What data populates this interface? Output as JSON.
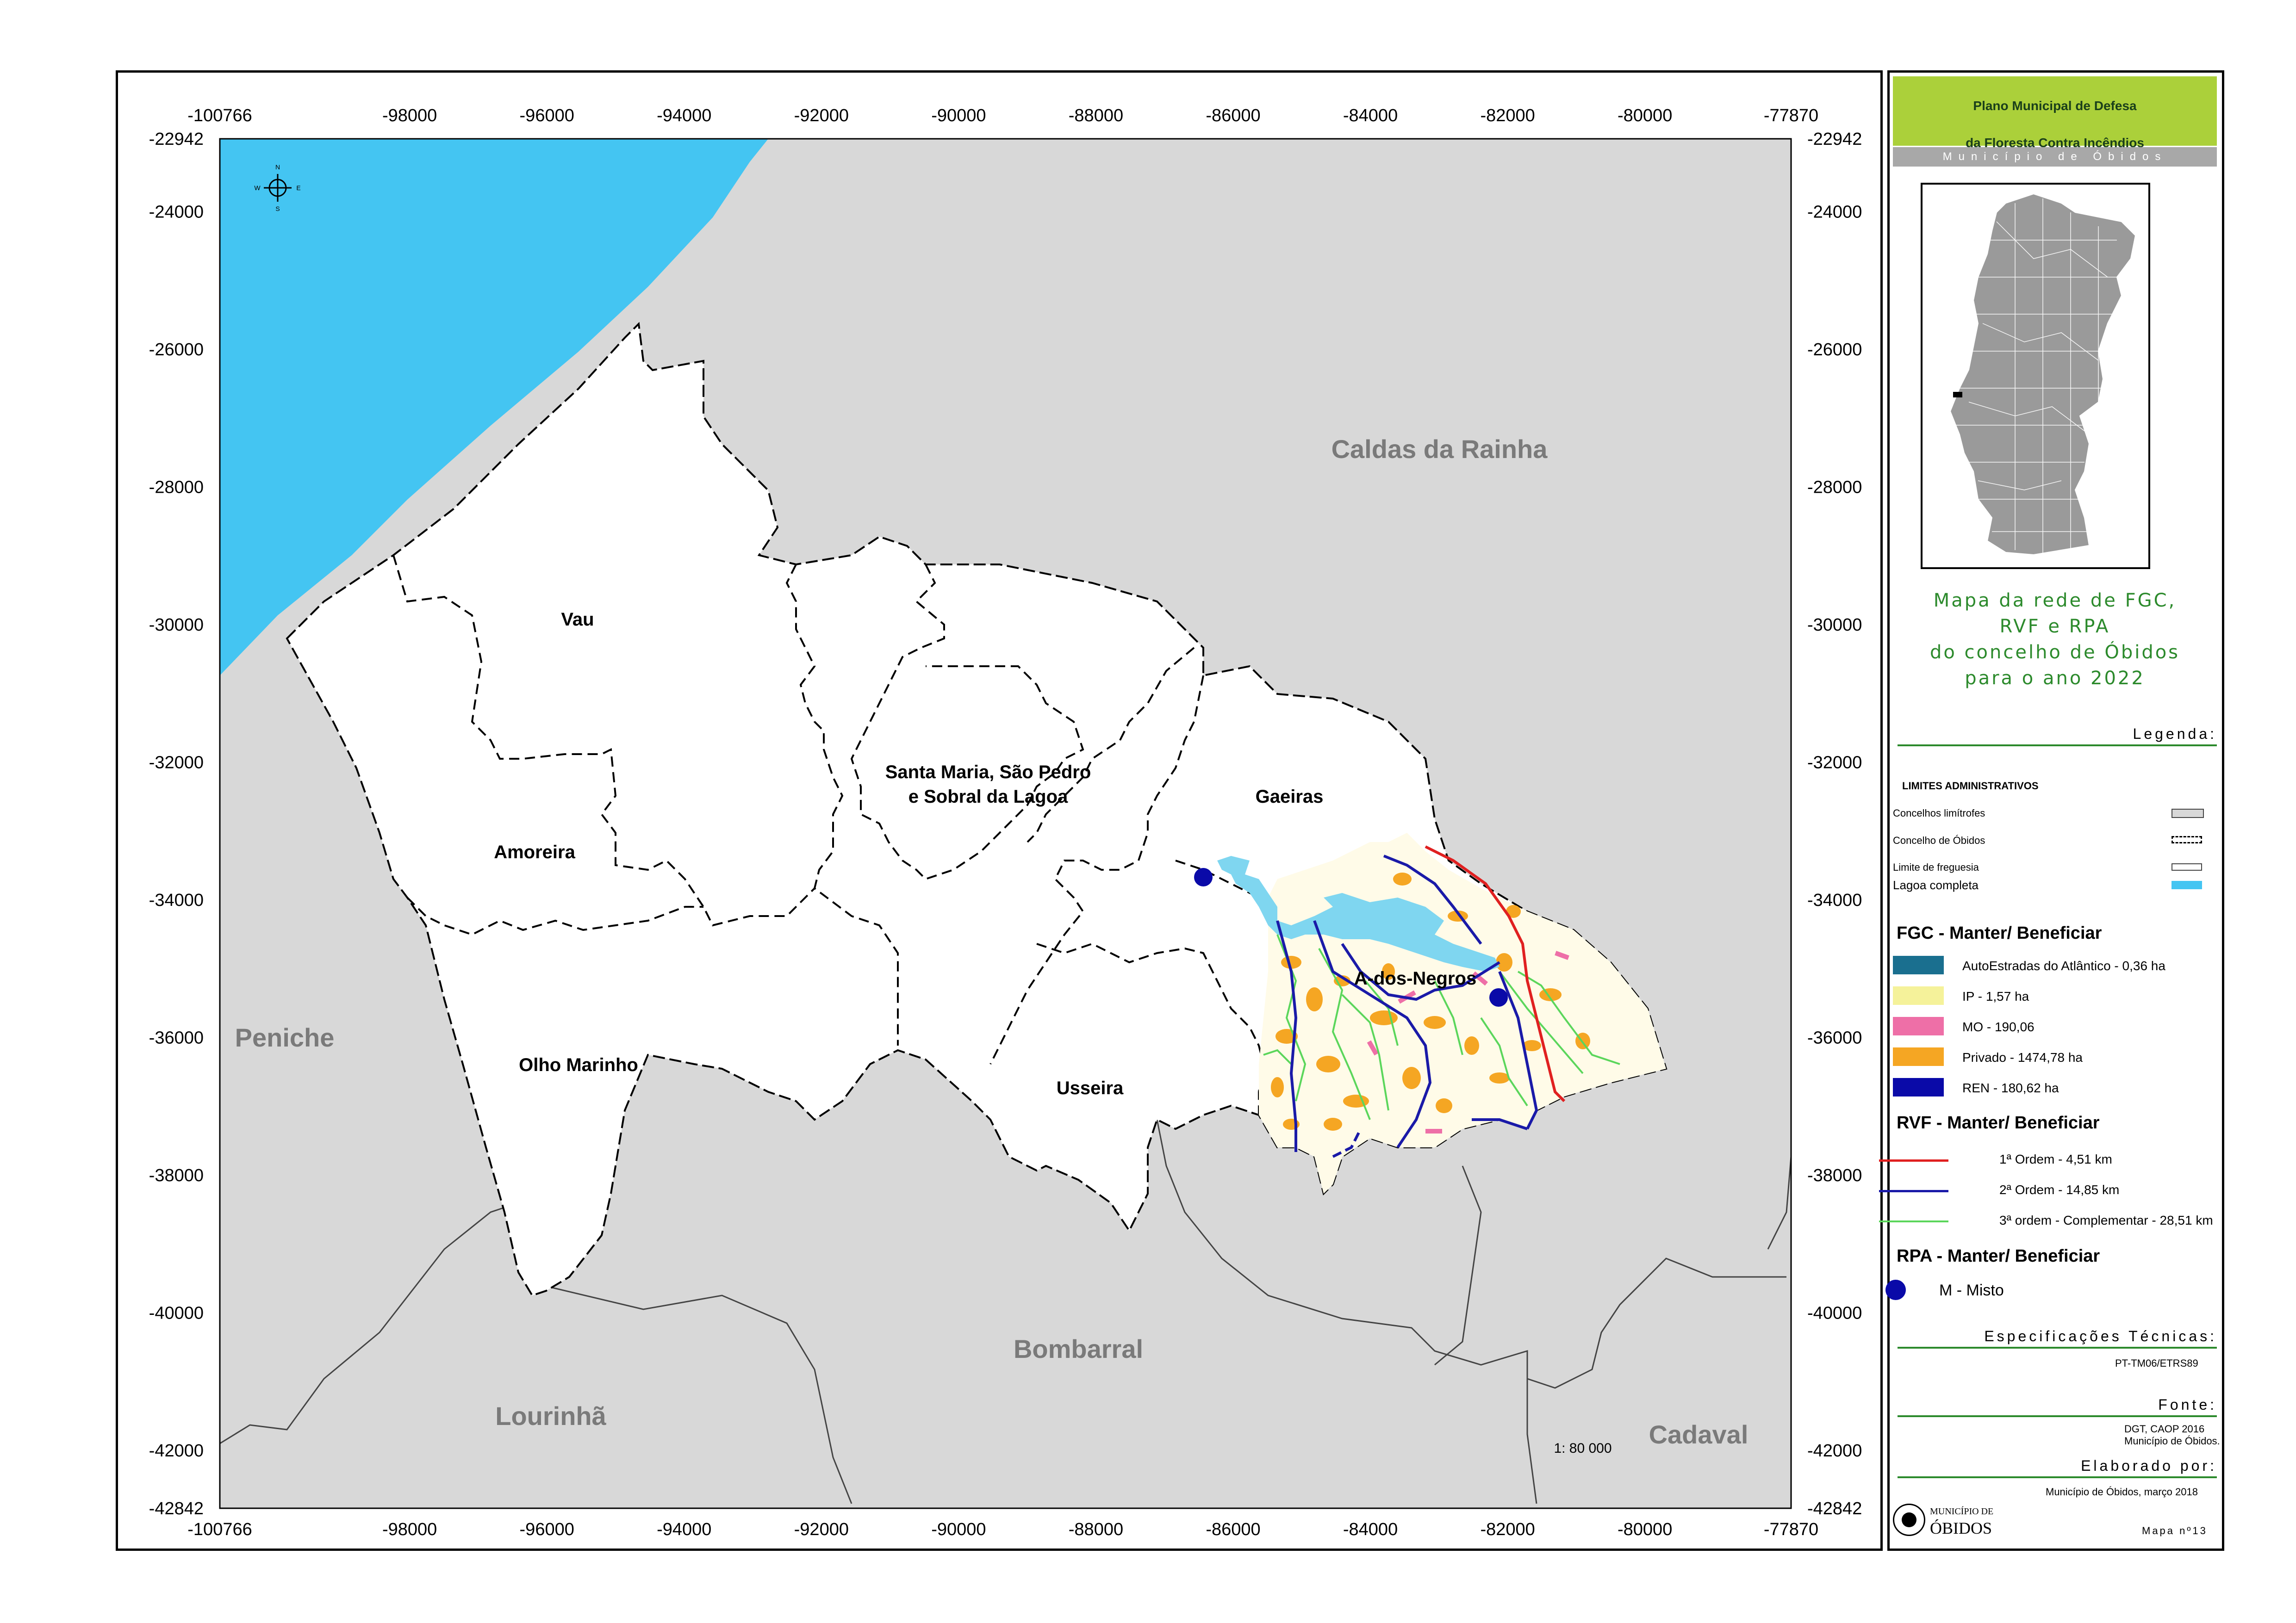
{
  "map": {
    "x_ticks": [
      "-100766",
      "-98000",
      "-96000",
      "-94000",
      "-92000",
      "-90000",
      "-88000",
      "-86000",
      "-84000",
      "-82000",
      "-80000",
      "-77870"
    ],
    "y_ticks": [
      "-22942",
      "-24000",
      "-26000",
      "-28000",
      "-30000",
      "-32000",
      "-34000",
      "-36000",
      "-38000",
      "-40000",
      "-42000",
      "-42842"
    ],
    "municipalities": {
      "caldas": "Caldas da Rainha",
      "peniche": "Peniche",
      "bombarral": "Bombarral",
      "lourinha": "Lourinhã",
      "cadaval": "Cadaval"
    },
    "parishes": {
      "vau": "Vau",
      "amoreira": "Amoreira",
      "santa_maria_1": "Santa Maria, São Pedro",
      "santa_maria_2": "e Sobral da Lagoa",
      "gaeiras": "Gaeiras",
      "a_dos_negros": "A-dos-Negros",
      "olho_marinho": "Olho Marinho",
      "usseira": "Usseira"
    },
    "scale": "1: 80 000",
    "compass": {
      "n": "N",
      "s": "S",
      "e": "E",
      "w": "W"
    },
    "colors": {
      "sea": "#44c5f2",
      "neighbor": "#d8d8d8",
      "lagoa": "#7fd6f0",
      "private": "#f5a623",
      "ren": "#0a0aa8"
    }
  },
  "legend": {
    "title_line1": "Plano Municipal de Defesa",
    "title_line2": "da Floresta Contra Incêndios",
    "subtitle": "Município de Óbidos",
    "map_title_1": "Mapa da rede de FGC,",
    "map_title_2": "RVF e RPA",
    "map_title_3": "do concelho de Óbidos",
    "map_title_4": "para o ano 2022",
    "legenda": "Legenda:",
    "limits_head": "LIMITES ADMINISTRATIVOS",
    "concelhos": "Concelhos limítrofes",
    "concelho_obidos": "Concelho de Óbidos",
    "limite_freguesia": "Limite de freguesia",
    "lagoa": "Lagoa completa",
    "fgc_head": "FGC - Manter/ Beneficiar",
    "fgc_items": [
      {
        "label": "AutoEstradas do Atlântico - 0,36 ha",
        "color": "#1a6f8f"
      },
      {
        "label": "IP - 1,57 ha",
        "color": "#f5f29a"
      },
      {
        "label": "MO - 190,06",
        "color": "#ee6fa7"
      },
      {
        "label": "Privado - 1474,78 ha",
        "color": "#f5a623"
      },
      {
        "label": "REN - 180,62 ha",
        "color": "#0a0aa8"
      }
    ],
    "rvf_head": "RVF - Manter/ Beneficiar",
    "rvf_items": [
      {
        "label": "1ª Ordem - 4,51 km",
        "color": "#e02020"
      },
      {
        "label": "2ª Ordem - 14,85 km",
        "color": "#1a1aa8"
      },
      {
        "label": "3ª ordem - Complementar - 28,51 km",
        "color": "#5bd65b"
      }
    ],
    "rpa_head": "RPA - Manter/ Beneficiar",
    "rpa_item": "M - Misto",
    "specs_head": "Especificações Técnicas:",
    "specs": "PT-TM06/ETRS89",
    "fonte_head": "Fonte:",
    "fonte_1": "DGT, CAOP 2016",
    "fonte_2": "Município de Óbidos.",
    "elab_head": "Elaborado por:",
    "elab": "Município de Óbidos, março 2018",
    "logo_1": "MUNICÍPIO DE",
    "logo_2": "ÓBIDOS",
    "map_no": "Mapa nº13"
  }
}
